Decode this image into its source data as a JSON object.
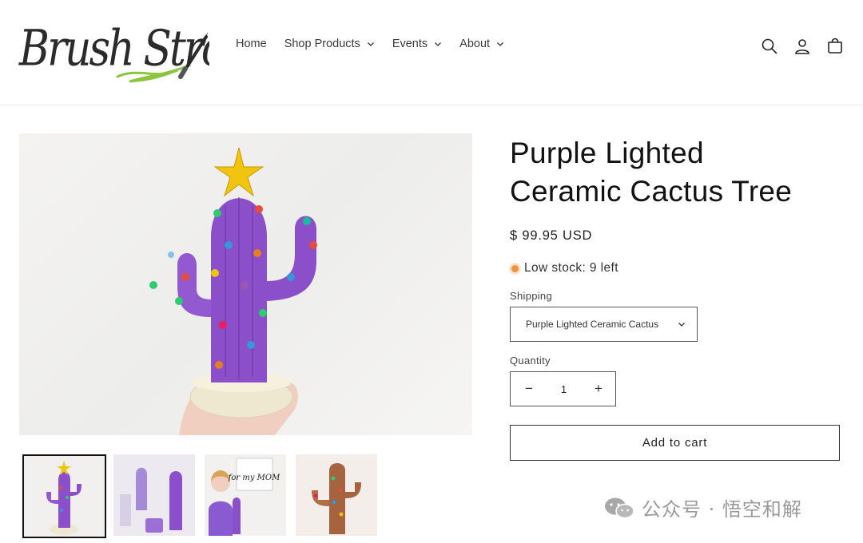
{
  "brand": {
    "logo_text": "Brush Strokes"
  },
  "nav": [
    {
      "label": "Home",
      "has_dropdown": false
    },
    {
      "label": "Shop Products",
      "has_dropdown": true
    },
    {
      "label": "Events",
      "has_dropdown": true
    },
    {
      "label": "About",
      "has_dropdown": true
    }
  ],
  "header_icons": [
    "search-icon",
    "account-icon",
    "cart-icon"
  ],
  "product": {
    "title_line1": "Purple Lighted",
    "title_line2": "Ceramic Cactus Tree",
    "price": "$ 99.95 USD",
    "stock": "Low stock: 9 left",
    "shipping_label": "Shipping",
    "shipping_value": "Purple Lighted Ceramic Cactus",
    "quantity_label": "Quantity",
    "quantity": "1",
    "minus": "−",
    "plus": "+",
    "add_to_cart": "Add to cart"
  },
  "thumb_overlay_text": "for my MOM",
  "watermark": "公众号 · 悟空和解",
  "colors": {
    "stock_dot": "#ee9441",
    "cactus": "#8a4fc9",
    "star": "#f1c40f",
    "logo_swoosh": "#8cc63f"
  }
}
